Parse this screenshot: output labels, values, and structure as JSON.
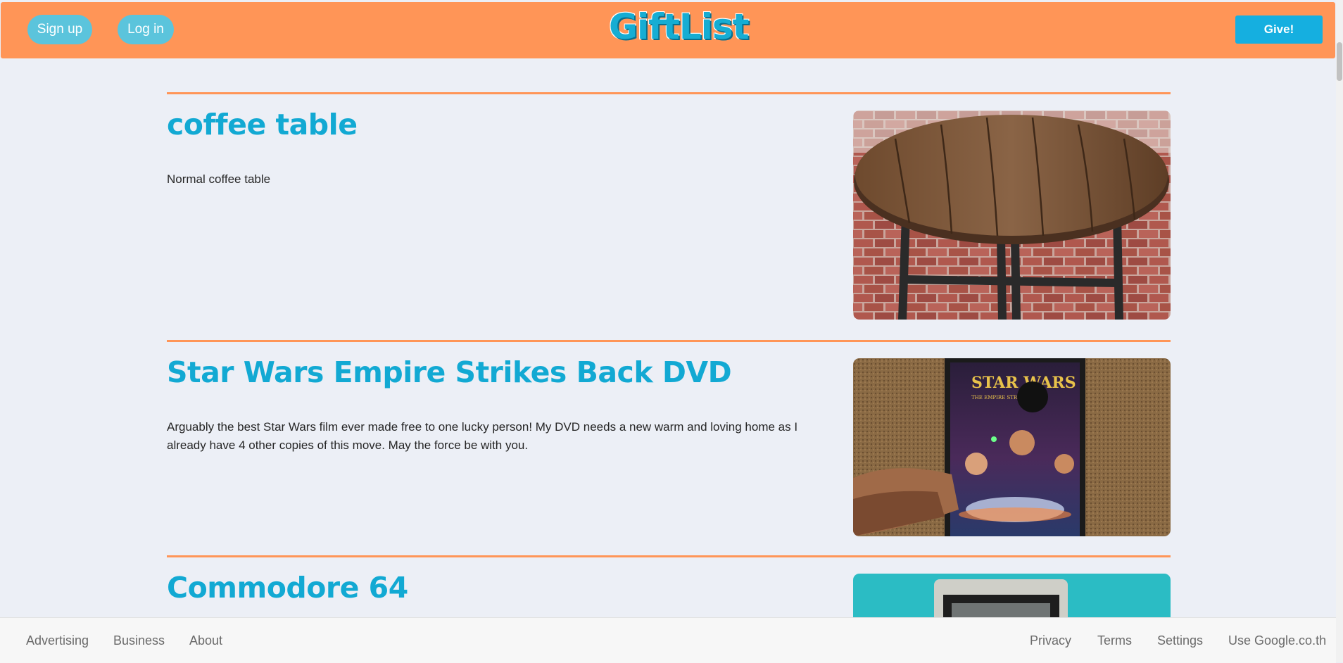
{
  "header": {
    "signup_label": "Sign up",
    "login_label": "Log in",
    "logo_text": "GiftList",
    "give_label": "Give!"
  },
  "items": [
    {
      "title": "coffee table",
      "description": "Normal coffee table",
      "image": "round wooden coffee table with black pipe legs on brick floor"
    },
    {
      "title": "Star Wars Empire Strikes Back DVD",
      "description": "Arguably the best Star Wars film ever made free to one lucky person! My DVD needs a new warm and loving home as I already have 4 other copies of this move. May the force be with you.",
      "image": "hand holding Star Wars The Empire Strikes Back DVD case",
      "dvd_cover_title": "STAR WARS",
      "dvd_cover_subtitle": "THE EMPIRE STRIKES BACK"
    },
    {
      "title": "Commodore 64",
      "description": "",
      "image": "vintage computer monitor on teal background"
    }
  ],
  "footer": {
    "left": [
      "Advertising",
      "Business",
      "About"
    ],
    "right": [
      "Privacy",
      "Terms",
      "Settings",
      "Use Google.co.th"
    ]
  },
  "colors": {
    "header_bg": "#ff9557",
    "accent_blue": "#12a9d3",
    "divider": "#ff9557",
    "page_bg": "#eceff6"
  }
}
